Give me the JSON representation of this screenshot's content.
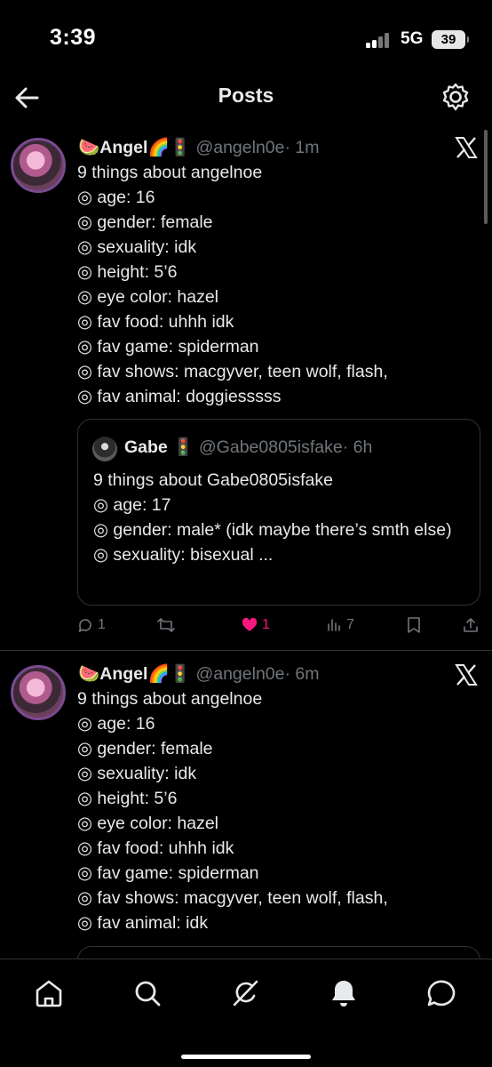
{
  "status_bar": {
    "time": "3:39",
    "network": "5G",
    "battery": "39"
  },
  "header": {
    "title": "Posts"
  },
  "posts": [
    {
      "name": "🍉Angel🌈🚦",
      "handle": "@angeln0e",
      "time": "· 1m",
      "lines": [
        "9 things about angelnoe",
        "◎ age: 16",
        "◎ gender: female",
        "◎ sexuality: idk",
        "◎ height: 5’6",
        "◎ eye color: hazel",
        "◎ fav food: uhhh idk",
        "◎ fav game: spiderman",
        "◎ fav shows: macgyver, teen wolf, flash,",
        "◎ fav animal: doggiesssss"
      ],
      "quote": {
        "name": "Gabe 🚦",
        "handle": "@Gabe0805isfake",
        "time": "· 6h",
        "lines": [
          "9 things about Gabe0805isfake",
          "◎ age: 17",
          "◎ gender: male* (idk maybe there’s smth else)",
          "◎ sexuality: bisexual ..."
        ]
      },
      "actions": {
        "replies": "1",
        "reposts": "",
        "likes": "1",
        "views": "7"
      }
    },
    {
      "name": "🍉Angel🌈🚦",
      "handle": "@angeln0e",
      "time": "· 6m",
      "lines": [
        "9 things about angelnoe",
        "◎ age: 16",
        "◎ gender: female",
        "◎ sexuality: idk",
        "◎ height: 5’6",
        "◎ eye color: hazel",
        "◎ fav food: uhhh idk",
        "◎ fav game: spiderman",
        "◎ fav shows: macgyver, teen wolf, flash,",
        "◎ fav animal: idk"
      ]
    }
  ],
  "nav": [
    "home-icon",
    "search-icon",
    "grok-icon",
    "notifications-icon",
    "messages-icon"
  ],
  "colors": {
    "like": "#f91880",
    "muted": "#71767b",
    "text": "#e7e9ea",
    "border": "#2f3336"
  }
}
